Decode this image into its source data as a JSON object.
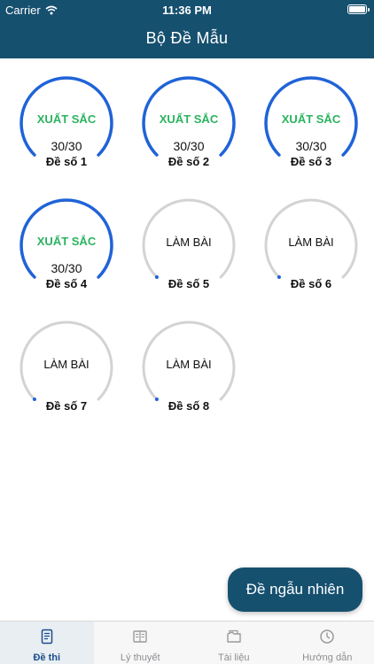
{
  "status_bar": {
    "carrier": "Carrier",
    "time": "11:36 PM"
  },
  "nav": {
    "title": "Bộ Đề Mẫu"
  },
  "colors": {
    "nav_bg": "#16506f",
    "ring_done": "#1f63d8",
    "ring_todo": "#d3d3d3",
    "excellent_text": "#2bb360",
    "tab_active": "#1b4e8c"
  },
  "tests": [
    {
      "name": "Đề số 1",
      "status": "XUẤT SẮC",
      "score": "30/30",
      "progress": 1.0
    },
    {
      "name": "Đề số 2",
      "status": "XUẤT SẮC",
      "score": "30/30",
      "progress": 1.0
    },
    {
      "name": "Đề số 3",
      "status": "XUẤT SẮC",
      "score": "30/30",
      "progress": 1.0
    },
    {
      "name": "Đề số 4",
      "status": "XUẤT SẮC",
      "score": "30/30",
      "progress": 1.0
    },
    {
      "name": "Đề số 5",
      "status": "LÀM BÀI",
      "score": "",
      "progress": 0
    },
    {
      "name": "Đề số 6",
      "status": "LÀM BÀI",
      "score": "",
      "progress": 0
    },
    {
      "name": "Đề số 7",
      "status": "LÀM BÀI",
      "score": "",
      "progress": 0
    },
    {
      "name": "Đề số 8",
      "status": "LÀM BÀI",
      "score": "",
      "progress": 0
    }
  ],
  "random_button": {
    "label": "Đề ngẫu nhiên"
  },
  "tabs": [
    {
      "label": "Đề thi",
      "icon": "exam-icon",
      "active": true
    },
    {
      "label": "Lý thuyết",
      "icon": "book-icon",
      "active": false
    },
    {
      "label": "Tài liệu",
      "icon": "documents-icon",
      "active": false
    },
    {
      "label": "Hướng dẫn",
      "icon": "clock-icon",
      "active": false
    }
  ]
}
